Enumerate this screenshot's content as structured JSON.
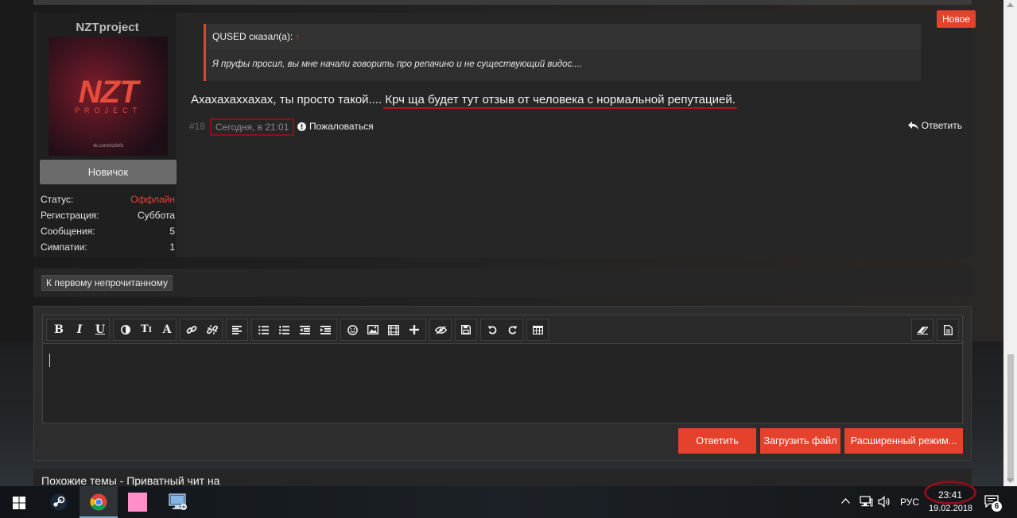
{
  "post": {
    "new_badge": "Новое",
    "user": {
      "name": "NZTproject",
      "avatar_logo": "NZT",
      "avatar_sub": "PROJECT",
      "avatar_url": "vk.com/nztinfo",
      "rank": "Новичок",
      "stats": [
        {
          "label": "Статус:",
          "value": "Оффлайн"
        },
        {
          "label": "Регистрация:",
          "value": "Суббота"
        },
        {
          "label": "Сообщения:",
          "value": "5"
        },
        {
          "label": "Симпатии:",
          "value": "1"
        }
      ]
    },
    "quote": {
      "author": "QUSED сказал(а):",
      "arrow": "↑",
      "text": "Я пруфы просил, вы мне начали говорить про репачино и не существующий видос...."
    },
    "message": {
      "part1": "Ахахахаххахах, ты просто такой....",
      "part2": "Крч ща будет тут отзыв от человека с нормальной репутацией."
    },
    "meta": {
      "number": "#18",
      "time": "Сегодня, в 21:01",
      "report": "Пожаловаться",
      "reply": "Ответить"
    }
  },
  "unread_button": "К первому непрочитанному",
  "editor": {
    "toolbar_icons": [
      "bold-icon",
      "italic-icon",
      "underline-icon",
      "color-icon",
      "text-size-icon",
      "font-icon",
      "link-icon",
      "unlink-icon",
      "align-icon",
      "bullet-list-icon",
      "numbered-list-icon",
      "outdent-icon",
      "indent-icon",
      "smiley-icon",
      "image-icon",
      "media-icon",
      "insert-icon",
      "spoiler-icon",
      "save-icon",
      "undo-icon",
      "redo-icon",
      "table-icon",
      "eraser-icon",
      "source-icon"
    ],
    "buttons": {
      "reply": "Ответить",
      "upload": "Загрузить файл",
      "advanced": "Расширенный режим..."
    }
  },
  "similar_title": "Похожие темы - Приватный чит на",
  "taskbar": {
    "apps": [
      "start-icon",
      "steam-icon",
      "chrome-icon",
      "pink-app-icon",
      "remote-desktop-icon"
    ],
    "language": "РУС",
    "time": "23:41",
    "date": "19.02.2018",
    "notifications": "6"
  },
  "colors": {
    "accent": "#e5422d",
    "highlight": "#b31321",
    "panel": "#262626"
  }
}
